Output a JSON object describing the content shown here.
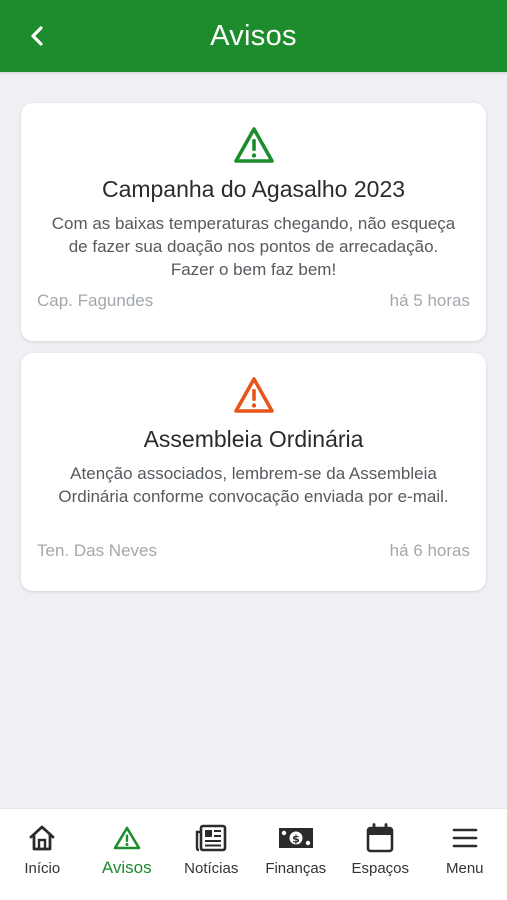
{
  "header": {
    "title": "Avisos"
  },
  "colors": {
    "primary": "#1c8c2c",
    "warning_green": "#1c8c2c",
    "warning_orange": "#e8551a"
  },
  "notices": [
    {
      "icon": "warning-triangle-icon",
      "title": "Campanha do Agasalho 2023",
      "body": "Com as baixas temperaturas chegando, não esqueça de fazer sua doação nos pontos de arrecadação. Fazer o bem faz bem!",
      "author": "Cap. Fagundes",
      "time": "há 5 horas"
    },
    {
      "icon": "warning-triangle-icon",
      "title": "Assembleia Ordinária",
      "body": "Atenção associados, lembrem-se da Assembleia Ordinária conforme convocação enviada por e-mail.",
      "author": "Ten. Das Neves",
      "time": "há 6 horas"
    }
  ],
  "tabs": [
    {
      "label": "Início",
      "icon": "home-icon"
    },
    {
      "label": "Avisos",
      "icon": "warning-triangle-icon",
      "active": true
    },
    {
      "label": "Notícias",
      "icon": "newspaper-icon"
    },
    {
      "label": "Finanças",
      "icon": "money-icon"
    },
    {
      "label": "Espaços",
      "icon": "calendar-icon"
    },
    {
      "label": "Menu",
      "icon": "hamburger-menu-icon"
    }
  ]
}
